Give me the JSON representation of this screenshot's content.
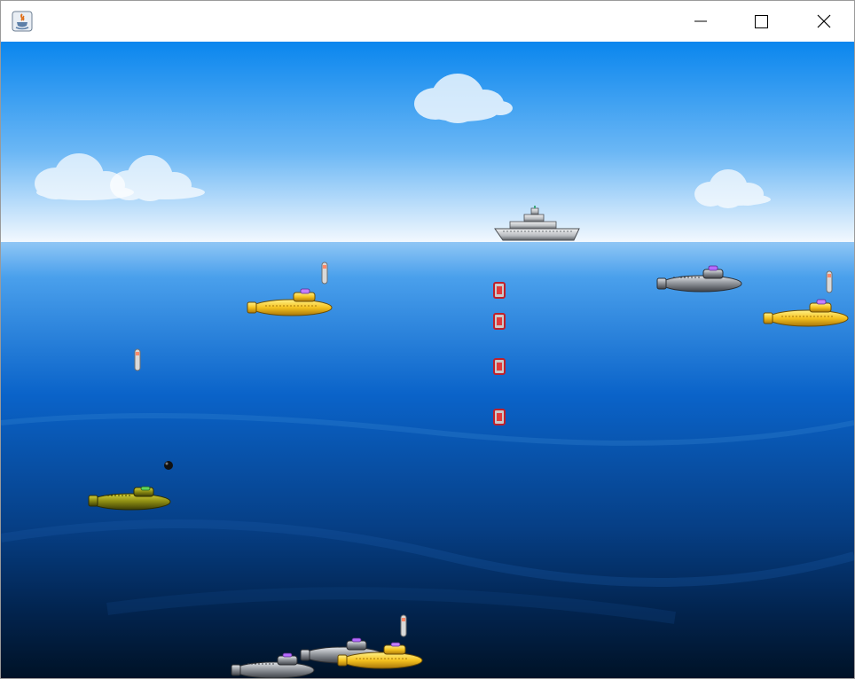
{
  "window": {
    "title": "",
    "controls": {
      "minimize": "minimize",
      "maximize": "maximize",
      "close": "close"
    }
  },
  "game": {
    "colors": {
      "sky_top": "#0a86ee",
      "sky_bottom": "#f2f8fe",
      "sea_top": "#8fc6f5",
      "sea_mid": "#0a63c9",
      "sea_bottom": "#001226",
      "yellow_sub": "#f5c21f",
      "gray_sub": "#8c9096",
      "olive_sub": "#8a8a12",
      "ship": "#b9bcc0"
    },
    "sprites": {
      "player_ship": "destroyer-ship-icon",
      "depth_charge": "depth-charge-icon",
      "torpedo": "torpedo-icon",
      "mine": "mine-icon",
      "yellow_submarine": "yellow-submarine-icon",
      "gray_submarine": "gray-submarine-icon",
      "olive_submarine": "olive-submarine-icon"
    },
    "counts": {
      "clouds": 4,
      "submarines": 7,
      "depth_charges": 4,
      "torpedoes": 4,
      "mines": 1
    }
  }
}
